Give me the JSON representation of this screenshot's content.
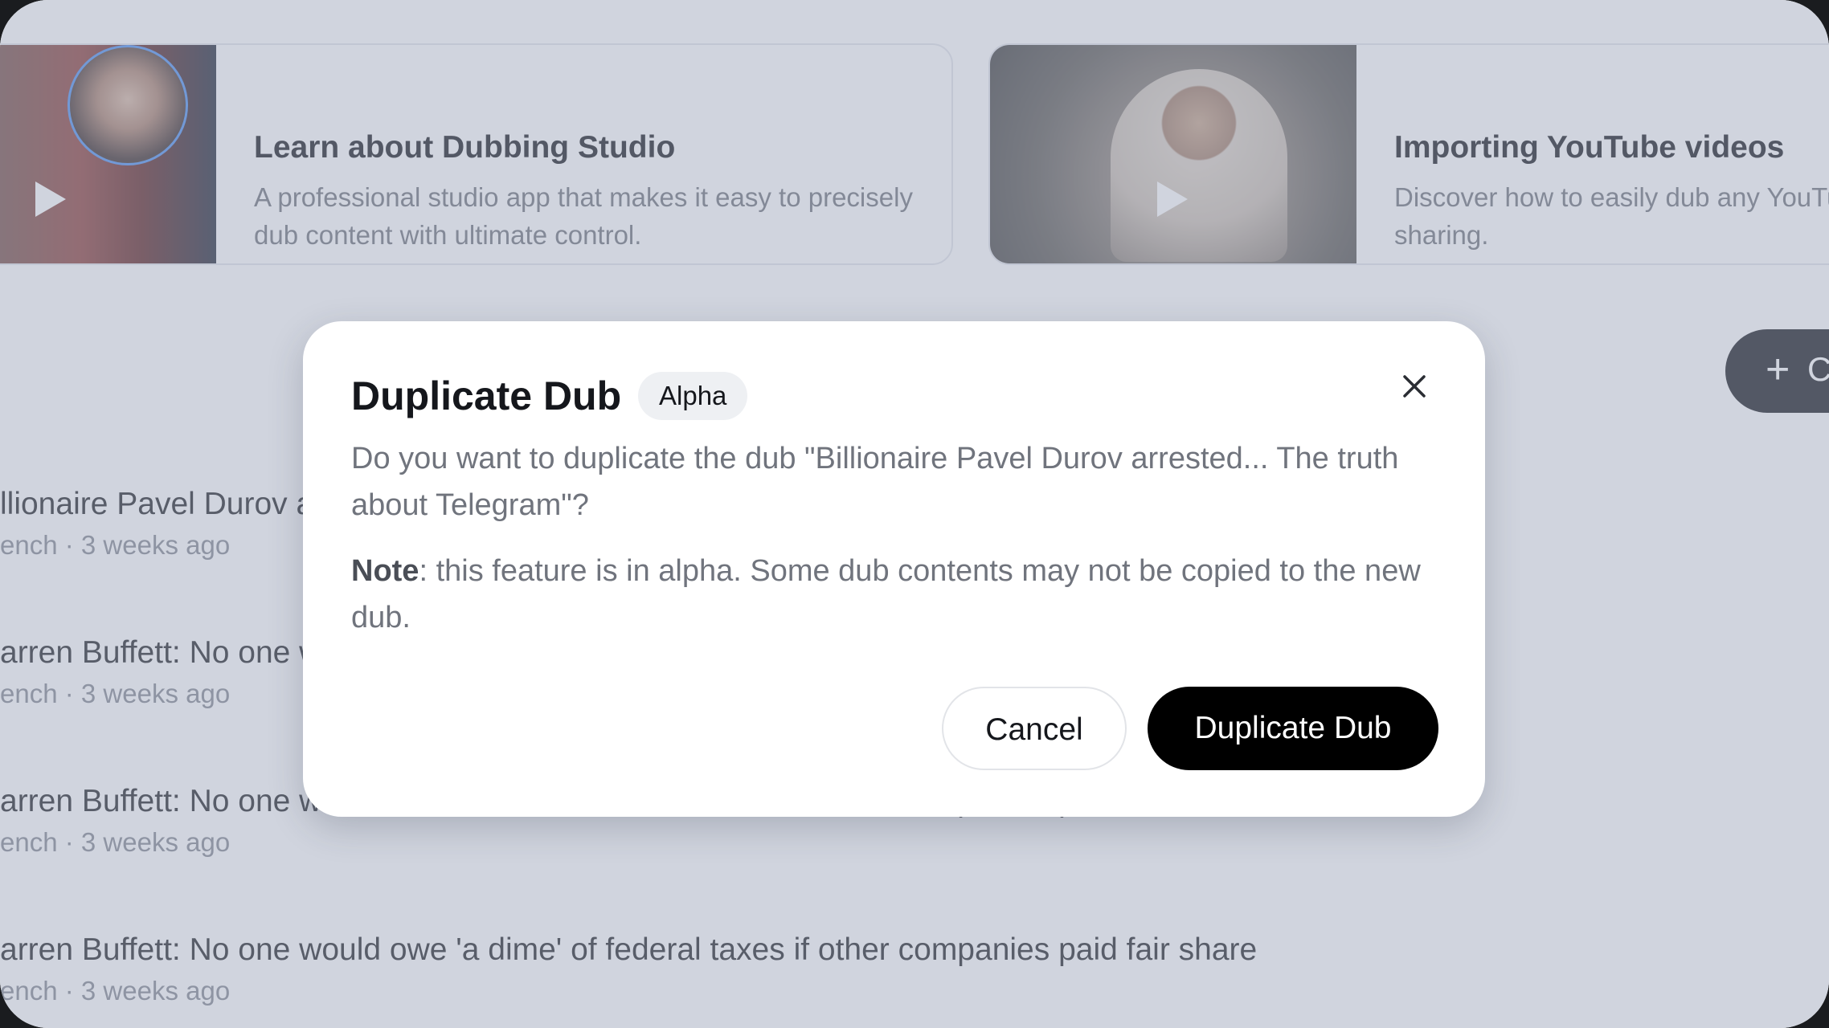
{
  "cards": [
    {
      "title": "Learn about Dubbing Studio",
      "description": "A professional studio app that makes it easy to precisely dub content with ultimate control."
    },
    {
      "title": "Importing YouTube videos",
      "description": "Discover how to easily dub any YouTube video for easy sharing."
    }
  ],
  "create_button": {
    "icon": "plus-icon",
    "label": "C"
  },
  "dub_list": [
    {
      "title": "llionaire Pavel Durov arrested... The truth about Telegram",
      "meta": "ench · 3 weeks ago"
    },
    {
      "title": "arren Buffett: No one would owe 'a dime' of federal taxes if other companies paid fair share",
      "meta": "ench · 3 weeks ago"
    },
    {
      "title": "arren Buffett: No one would owe 'a dime' of federal taxes if other companies paid fair share",
      "meta": "ench · 3 weeks ago"
    },
    {
      "title": "arren Buffett: No one would owe 'a dime' of federal taxes if other companies paid fair share",
      "meta": "ench · 3 weeks ago"
    }
  ],
  "modal": {
    "title": "Duplicate Dub",
    "badge": "Alpha",
    "message": "Do you want to duplicate the dub \"Billionaire Pavel Durov arrested... The truth about Telegram\"?",
    "note_label": "Note",
    "note_text": ": this feature is in alpha. Some dub contents may not be copied to the new dub.",
    "cancel_label": "Cancel",
    "confirm_label": "Duplicate Dub",
    "close_icon": "close-icon"
  }
}
